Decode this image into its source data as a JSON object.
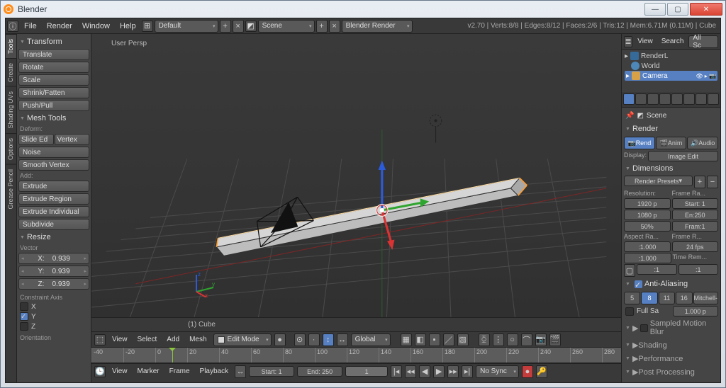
{
  "window": {
    "title": "Blender"
  },
  "topbar": {
    "menus": [
      "File",
      "Render",
      "Window",
      "Help"
    ],
    "layout_dropdown": "Default",
    "scene_dropdown": "Scene",
    "engine_dropdown": "Blender Render",
    "stats": "v2.70 | Verts:8/8 | Edges:8/12 | Faces:2/6 | Tris:12 | Mem:6.71M (0.11M) | Cube"
  },
  "vtabs": [
    "Tools",
    "Create",
    "Shading UVs",
    "Options",
    "Grease Pencil"
  ],
  "toolshelf": {
    "transform_header": "Transform",
    "transform_ops": [
      "Translate",
      "Rotate",
      "Scale",
      "Shrink/Fatten",
      "Push/Pull"
    ],
    "mesh_tools_header": "Mesh Tools",
    "deform_label": "Deform:",
    "slide_edge": "Slide Ed",
    "vertex": "Vertex",
    "noise": "Noise",
    "smooth_vertex": "Smooth Vertex",
    "add_label": "Add:",
    "extrude": "Extrude",
    "extrude_region": "Extrude Region",
    "extrude_individual": "Extrude Individual",
    "subdivide": "Subdivide",
    "resize_header": "Resize",
    "vector_label": "Vector",
    "vec_x_label": "X:",
    "vec_x": "0.939",
    "vec_y_label": "Y:",
    "vec_y": "0.939",
    "vec_z_label": "Z:",
    "vec_z": "0.939",
    "constraint_label": "Constraint Axis",
    "axis_x": "X",
    "axis_y": "Y",
    "axis_z": "Z",
    "orientation_label": "Orientation"
  },
  "viewport": {
    "persp_label": "User Persp",
    "object_label": "(1) Cube"
  },
  "view3d_header": {
    "menus": [
      "View",
      "Select",
      "Add",
      "Mesh"
    ],
    "mode": "Edit Mode",
    "orientation": "Global"
  },
  "timeline": {
    "ticks": [
      -40,
      -20,
      0,
      20,
      40,
      60,
      80,
      100,
      120,
      140,
      160,
      180,
      200,
      220,
      240,
      260,
      280
    ],
    "current": 1,
    "menus": [
      "View",
      "Marker",
      "Frame",
      "Playback"
    ],
    "start_label": "Start:",
    "start": 1,
    "end_label": "End:",
    "end": 250,
    "sync": "No Sync"
  },
  "outliner": {
    "menus": [
      "View",
      "Search"
    ],
    "filter": "All Sc",
    "items": [
      {
        "name": "RenderL",
        "icon": "#366b99"
      },
      {
        "name": "World",
        "icon": "#4d88b8"
      },
      {
        "name": "Camera",
        "icon": "#d8a047",
        "selected": true
      }
    ]
  },
  "properties": {
    "scene_label": "Scene",
    "render_header": "Render",
    "seg_render": "Rend",
    "seg_anim": "Anim",
    "seg_audio": "Audio",
    "display_label": "Display:",
    "display_value": "Image Edit",
    "dimensions_header": "Dimensions",
    "render_presets": "Render Presets",
    "resolution_label": "Resolution:",
    "frame_range_label": "Frame Ra...",
    "res_x": "1920 p",
    "res_y": "1080 p",
    "res_pct": "50%",
    "start_frame": "Start: 1",
    "end_frame": "En:250",
    "frame_step": "Fram:1",
    "aspect_label": "Aspect Ra...",
    "frame_rate_label": "Frame R...",
    "aspect_x": ":1.000",
    "aspect_y": ":1.000",
    "fps": "24 fps",
    "time_remap": "Time Rem...",
    "old1": ":1",
    "new1": ":1",
    "antialias_header": "Anti-Aliasing",
    "aa5": "5",
    "aa8": "8",
    "aa11": "11",
    "aa16": "16",
    "aa_filter": "Mitchell-",
    "full_sample": "Full Sa",
    "filter_size": "1.000 p",
    "motion_blur_header": "Sampled Motion Blur",
    "shading_header": "Shading",
    "performance_header": "Performance",
    "post_header": "Post Processing"
  }
}
